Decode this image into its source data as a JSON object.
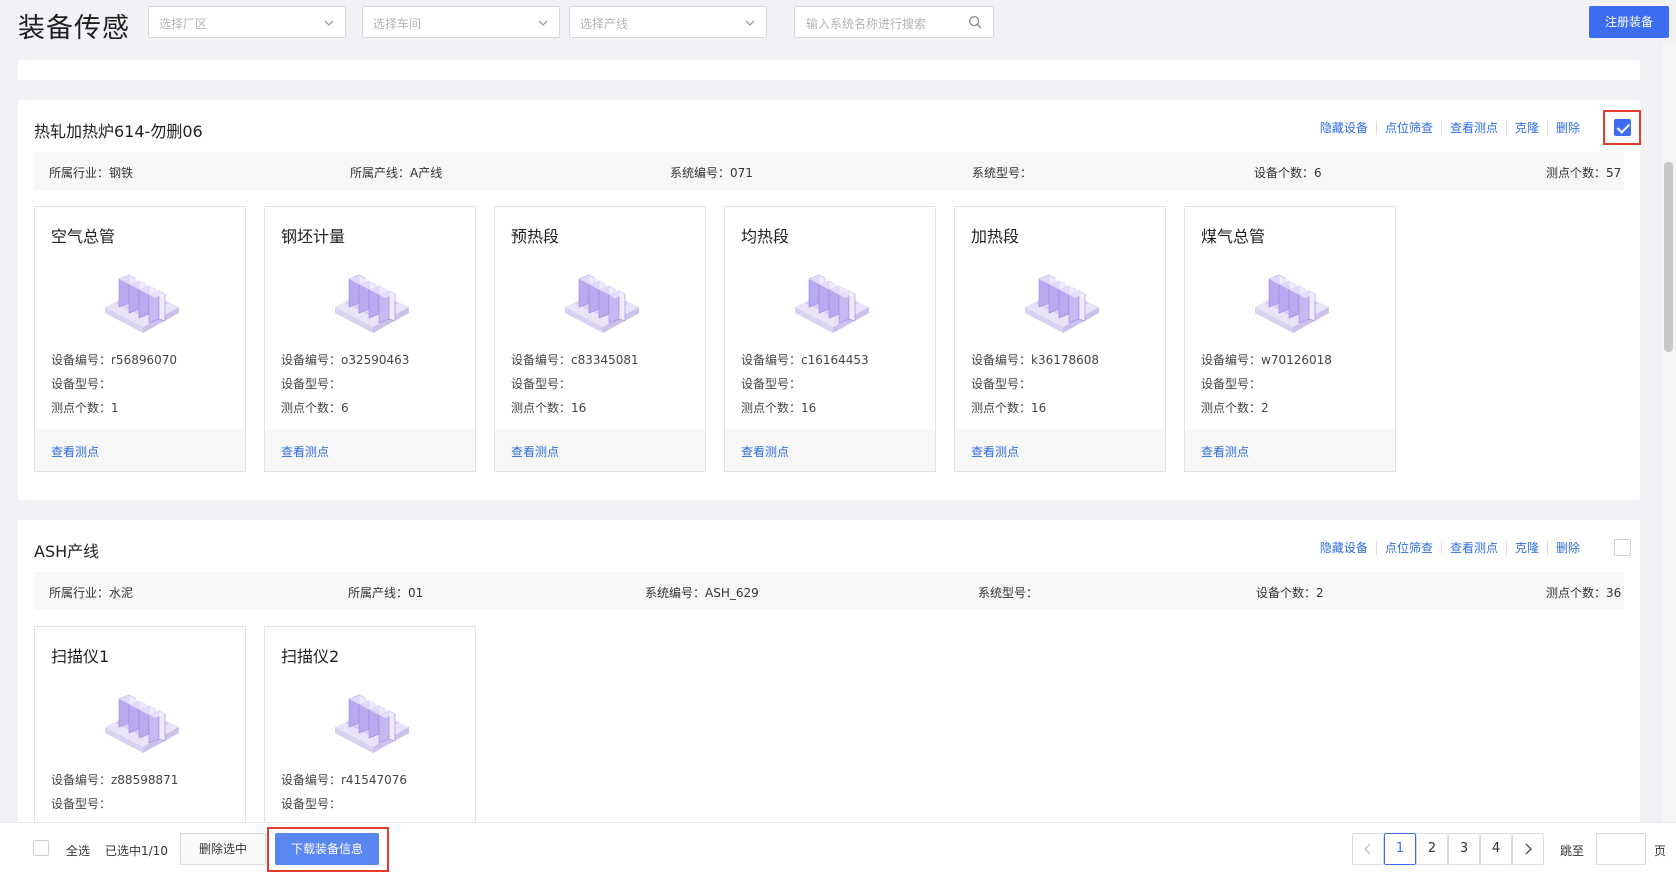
{
  "header": {
    "title": "装备传感",
    "select_factory_placeholder": "选择厂区",
    "select_workshop_placeholder": "选择车间",
    "select_line_placeholder": "选择产线",
    "search_placeholder": "输入系统名称进行搜索",
    "register_label": "注册装备"
  },
  "group_actions": [
    "隐藏设备",
    "点位筛查",
    "查看测点",
    "克隆",
    "删除"
  ],
  "groups": [
    {
      "name": "热轧加热炉614-勿删06",
      "selected": true,
      "info": {
        "industry": "所属行业：钢铁",
        "line": "所属产线：A产线",
        "system_no": "系统编号：071",
        "system_model": "系统型号：",
        "device_count": "设备个数：6",
        "point_count": "测点个数：57"
      },
      "devices": [
        {
          "name": "空气总管",
          "code": "设备编号：r56896070",
          "model": "设备型号：",
          "points": "测点个数：1",
          "link": "查看测点"
        },
        {
          "name": "钢坯计量",
          "code": "设备编号：o32590463",
          "model": "设备型号：",
          "points": "测点个数：6",
          "link": "查看测点"
        },
        {
          "name": "预热段",
          "code": "设备编号：c83345081",
          "model": "设备型号：",
          "points": "测点个数：16",
          "link": "查看测点"
        },
        {
          "name": "均热段",
          "code": "设备编号：c16164453",
          "model": "设备型号：",
          "points": "测点个数：16",
          "link": "查看测点"
        },
        {
          "name": "加热段",
          "code": "设备编号：k36178608",
          "model": "设备型号：",
          "points": "测点个数：16",
          "link": "查看测点"
        },
        {
          "name": "煤气总管",
          "code": "设备编号：w70126018",
          "model": "设备型号：",
          "points": "测点个数：2",
          "link": "查看测点"
        }
      ]
    },
    {
      "name": "ASH产线",
      "selected": false,
      "info": {
        "industry": "所属行业：水泥",
        "line": "所属产线：01",
        "system_no": "系统编号：ASH_629",
        "system_model": "系统型号：",
        "device_count": "设备个数：2",
        "point_count": "测点个数：36"
      },
      "devices": [
        {
          "name": "扫描仪1",
          "code": "设备编号：z88598871",
          "model": "设备型号："
        },
        {
          "name": "扫描仪2",
          "code": "设备编号：r41547076",
          "model": "设备型号："
        }
      ]
    }
  ],
  "footer": {
    "select_all": "全选",
    "selected_text": "已选中1/10",
    "delete_selected": "删除选中",
    "download": "下载装备信息",
    "pages": [
      "1",
      "2",
      "3",
      "4"
    ],
    "current_page": "1",
    "jump_to": "跳至",
    "page_unit": "页"
  },
  "colors": {
    "primary": "#3c6df0",
    "link": "#2f6ce0",
    "highlight_border": "#e53b2c"
  }
}
